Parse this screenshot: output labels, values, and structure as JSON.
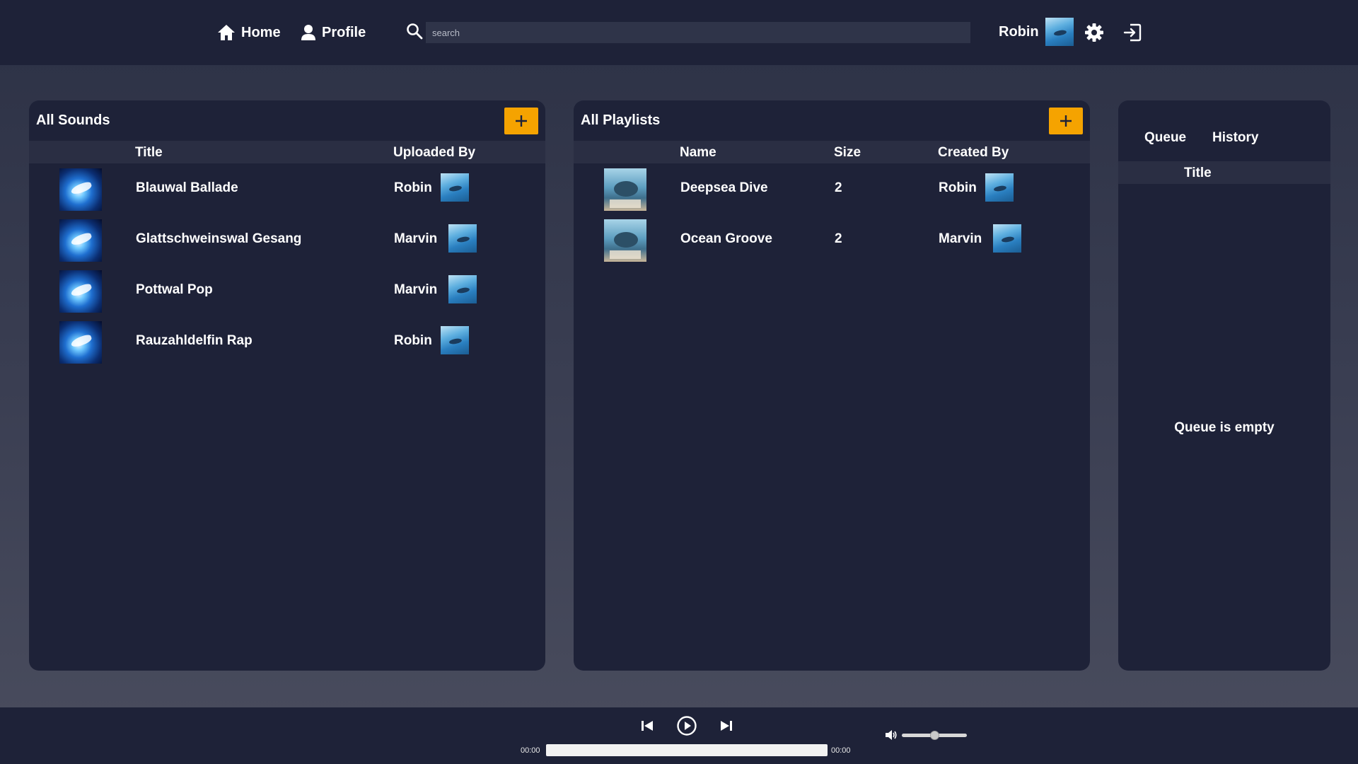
{
  "header": {
    "nav": [
      {
        "label": "Home",
        "icon": "home-icon"
      },
      {
        "label": "Profile",
        "icon": "person-icon"
      }
    ],
    "search": {
      "placeholder": "search",
      "value": ""
    },
    "user": {
      "name": "Robin"
    }
  },
  "sounds": {
    "title": "All Sounds",
    "columns": [
      "Title",
      "Uploaded By"
    ],
    "rows": [
      {
        "title": "Blauwal Ballade",
        "uploader": "Robin"
      },
      {
        "title": "Glattschweinswal Gesang",
        "uploader": "Marvin"
      },
      {
        "title": "Pottwal Pop",
        "uploader": "Marvin"
      },
      {
        "title": "Rauzahldelfin Rap",
        "uploader": "Robin"
      }
    ]
  },
  "playlists": {
    "title": "All Playlists",
    "columns": [
      "Name",
      "Size",
      "Created By"
    ],
    "rows": [
      {
        "name": "Deepsea Dive",
        "size": "2",
        "creator": "Robin"
      },
      {
        "name": "Ocean Groove",
        "size": "2",
        "creator": "Marvin"
      }
    ]
  },
  "queue": {
    "tabs": [
      "Queue",
      "History"
    ],
    "column": "Title",
    "empty_message": "Queue is empty"
  },
  "player": {
    "current_time": "00:00",
    "duration": "00:00",
    "progress": 0,
    "volume": 0.5
  },
  "colors": {
    "accent": "#f5a300",
    "panel": "#1e2238",
    "header_row": "#2a2e43"
  }
}
